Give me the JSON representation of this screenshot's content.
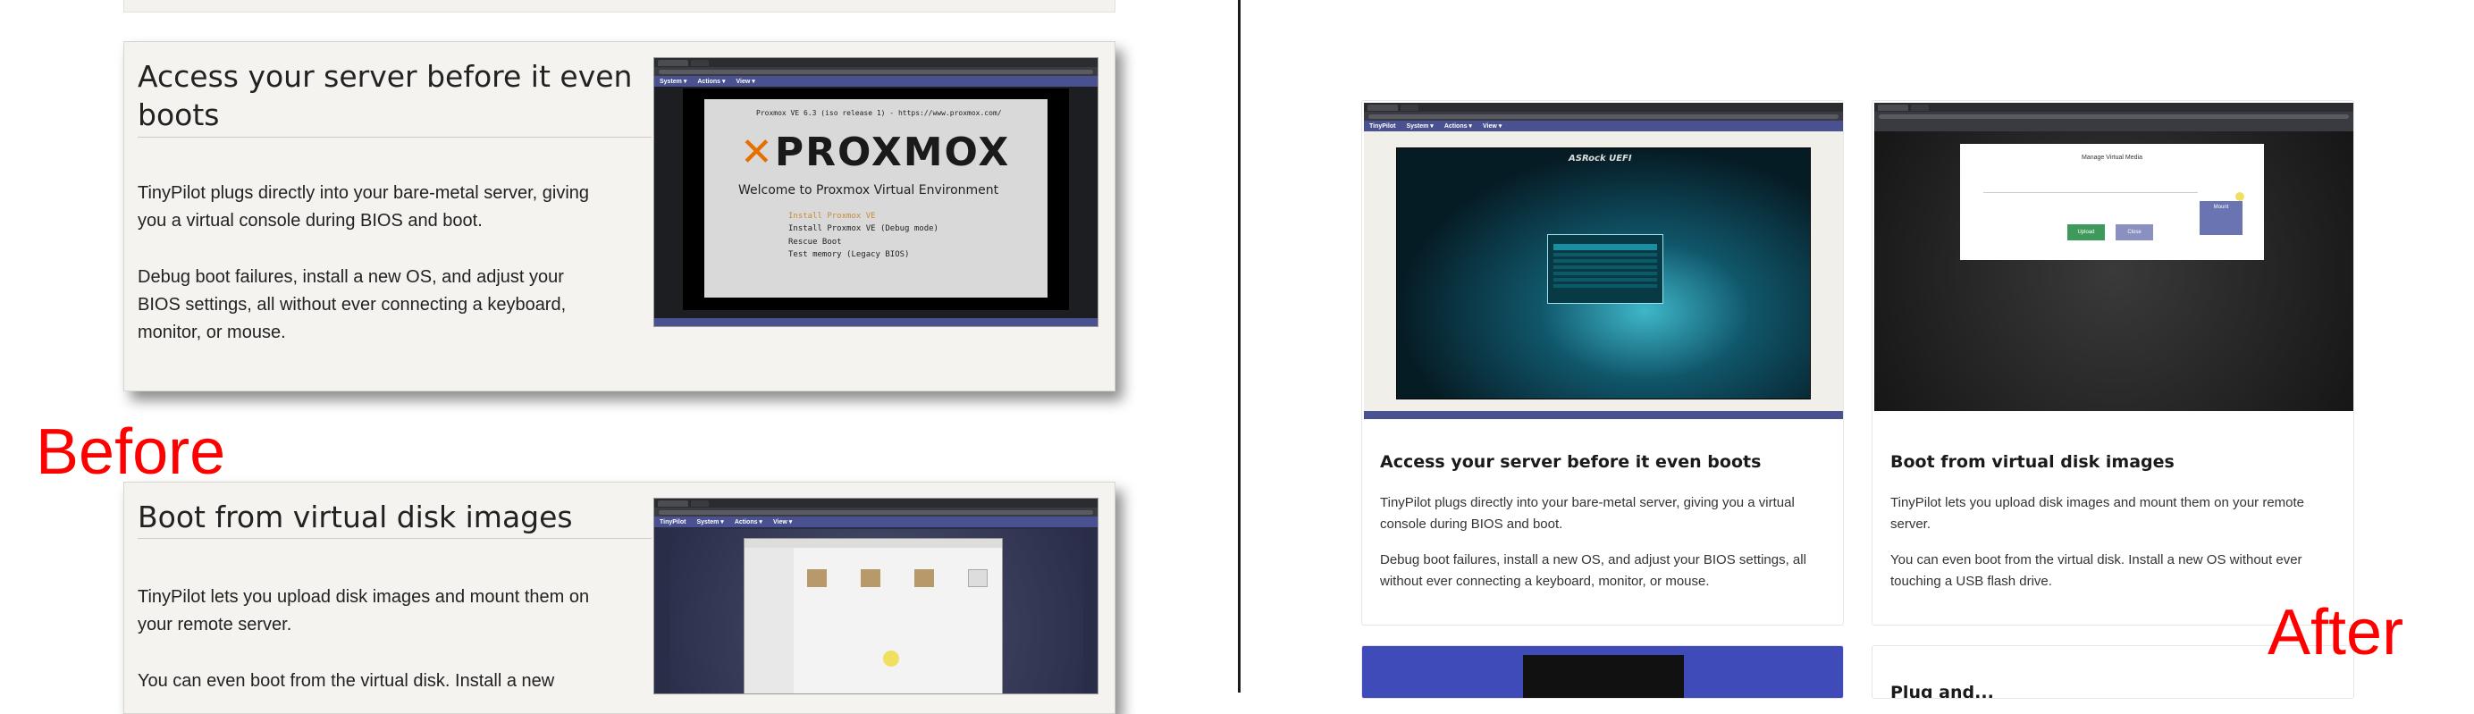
{
  "labels": {
    "before": "Before",
    "after": "After"
  },
  "before": {
    "card1": {
      "title": "Access your server before it even boots",
      "p1": "TinyPilot plugs directly into your bare-metal server, giving you a virtual console during BIOS and boot.",
      "p2": "Debug boot failures, install a new OS, and adjust your BIOS settings, all without ever connecting a keyboard, monitor, or mouse.",
      "screenshot": {
        "menu": [
          "System ▾",
          "Actions ▾",
          "View ▾"
        ],
        "header_line": "Proxmox VE 6.3 (iso release 1) - https://www.proxmox.com/",
        "logo": "PROXMOX",
        "welcome": "Welcome to Proxmox Virtual Environment",
        "boot_options": [
          "Install Proxmox VE",
          "Install Proxmox VE (Debug mode)",
          "Rescue Boot",
          "Test memory (Legacy BIOS)"
        ]
      }
    },
    "card2": {
      "title": "Boot from virtual disk images",
      "p1": "TinyPilot lets you upload disk images and mount them on your remote server.",
      "p2": "You can even boot from the virtual disk. Install a new",
      "screenshot": {
        "brand": "TinyPilot",
        "menu": [
          "System ▾",
          "Actions ▾",
          "View ▾"
        ]
      }
    }
  },
  "after": {
    "card1": {
      "title": "Access your server before it even boots",
      "p1": "TinyPilot plugs directly into your bare-metal server, giving you a virtual console during BIOS and boot.",
      "p2": "Debug boot failures, install a new OS, and adjust your BIOS settings, all without ever connecting a keyboard, monitor, or mouse.",
      "screenshot": {
        "brand": "TinyPilot",
        "menu": [
          "System ▾",
          "Actions ▾",
          "View ▾"
        ],
        "bios_title": "ASRock UEFI"
      }
    },
    "card2": {
      "title": "Boot from virtual disk images",
      "p1": "TinyPilot lets you upload disk images and mount them on your remote server.",
      "p2": "You can even boot from the virtual disk. Install a new OS without ever touching a USB flash drive.",
      "screenshot": {
        "dialog_title": "Manage Virtual Media",
        "upload": "Upload",
        "close": "Close",
        "mount": "Mount"
      }
    },
    "card4": {
      "title": "Plug and..."
    }
  },
  "colors": {
    "label_red": "#ff0000",
    "navbar": "#4a5190",
    "proxmox_orange": "#e57000"
  }
}
